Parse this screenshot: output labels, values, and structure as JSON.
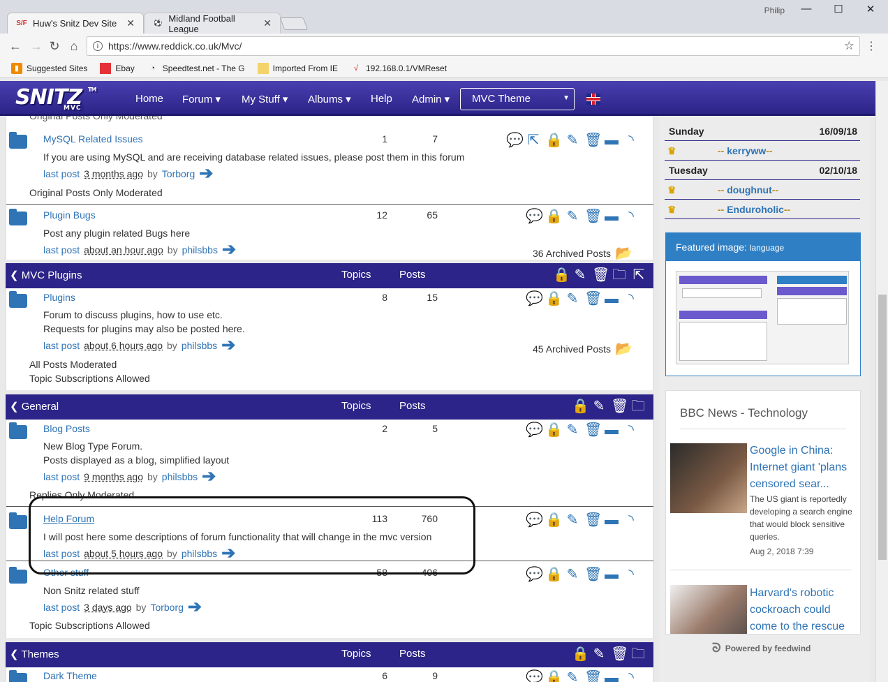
{
  "browser": {
    "tabs": [
      {
        "title": "Huw's Snitz Dev Site",
        "favicon": "S/F"
      },
      {
        "title": "Midland Football League",
        "favicon": "ball"
      }
    ],
    "user": "Philip",
    "url": "https://www.reddick.co.uk/Mvc/",
    "bookmarks": [
      "Suggested Sites",
      "Ebay",
      "Speedtest.net - The G",
      "Imported From IE",
      "192.168.0.1/VMReset"
    ]
  },
  "site": {
    "logo": "SNITZ",
    "logo_sub": "MVC",
    "logo_tm": "TM",
    "nav": [
      "Home",
      "Forum ▾",
      "My Stuff ▾",
      "Albums ▾",
      "Help",
      "Admin ▾"
    ],
    "theme_select": "MVC Theme"
  },
  "forums": {
    "topic_header": "Topics",
    "posts_header": "Posts",
    "cut_note": "Original Posts Only Moderated",
    "mysql": {
      "title": "MySQL Related Issues",
      "topics": "1",
      "posts": "7",
      "desc": "If you are using MySQL and are receiving database related issues, please post them in this forum",
      "lastpost": "last post",
      "ago": "3 months ago",
      "by": "by",
      "user": "Torborg",
      "note": "Original Posts Only Moderated"
    },
    "pluginbugs": {
      "title": "Plugin Bugs",
      "topics": "12",
      "posts": "65",
      "desc": "Post any plugin related Bugs here",
      "lastpost": "last post",
      "ago": "about an hour ago",
      "by": "by",
      "user": "philsbbs",
      "archived": "36 Archived Posts"
    },
    "cat_mvcplugins": "MVC Plugins",
    "plugins": {
      "title": "Plugins",
      "topics": "8",
      "posts": "15",
      "desc1": "Forum to discuss plugins, how to use etc.",
      "desc2": "Requests for plugins may also be posted here.",
      "lastpost": "last post",
      "ago": "about 6 hours ago",
      "by": "by",
      "user": "philsbbs",
      "archived": "45 Archived Posts",
      "note1": "All Posts Moderated",
      "note2": "Topic Subscriptions Allowed"
    },
    "cat_general": "General",
    "blog": {
      "title": "Blog Posts",
      "topics": "2",
      "posts": "5",
      "desc1": "New Blog Type Forum.",
      "desc2": "Posts displayed as a blog, simplified layout",
      "lastpost": "last post",
      "ago": "9 months ago",
      "by": "by",
      "user": "philsbbs",
      "note": "Replies Only Moderated"
    },
    "help": {
      "title": "Help Forum",
      "topics": "113",
      "posts": "760",
      "desc": "I will post here some descriptions of forum functionality that will change in the mvc version",
      "lastpost": "last post",
      "ago": "about 5 hours ago",
      "by": "by",
      "user": "philsbbs"
    },
    "other": {
      "title": "Other stuff",
      "topics": "58",
      "posts": "406",
      "desc": "Non Snitz related stuff",
      "lastpost": "last post",
      "ago": "3 days ago",
      "by": "by",
      "user": "Torborg",
      "note": "Topic Subscriptions Allowed"
    },
    "cat_themes": "Themes",
    "dark": {
      "title": "Dark Theme",
      "topics": "6",
      "posts": "9"
    }
  },
  "sidebar": {
    "birthdays": [
      {
        "day": "Sunday",
        "date": "16/09/18",
        "names": [
          "kerryww"
        ]
      },
      {
        "day": "Tuesday",
        "date": "02/10/18",
        "names": [
          "doughnut",
          "Enduroholic"
        ]
      }
    ],
    "featured_label": "Featured image:",
    "featured_value": "language",
    "bbc_header": "BBC News - Technology",
    "news": [
      {
        "title": "Google in China: Internet giant 'plans censored sear...",
        "body": "The US giant is reportedly developing a search engine that would block sensitive queries.",
        "date": "Aug 2, 2018 7:39"
      },
      {
        "title": "Harvard's robotic cockroach could come to the rescue"
      }
    ],
    "powered": "Powered by feedwind"
  },
  "colors": {
    "brand": "#2c2488",
    "link": "#2f74b5"
  }
}
